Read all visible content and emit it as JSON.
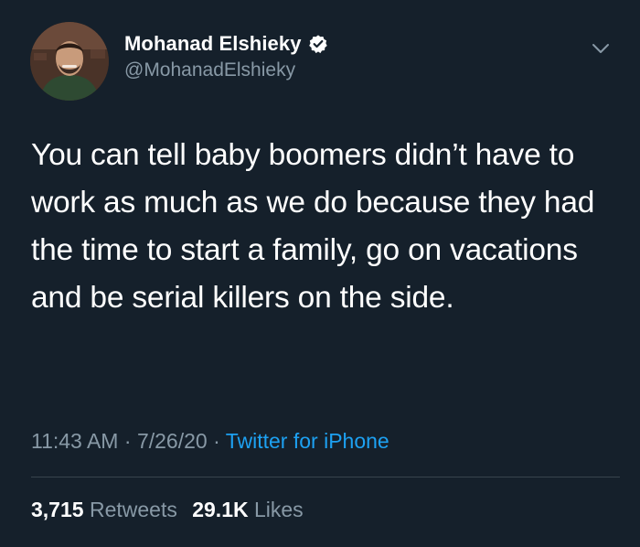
{
  "author": {
    "name": "Mohanad Elshieky",
    "handle": "@MohanadElshieky",
    "verified": true
  },
  "tweet": {
    "text": "You can tell baby boomers didn’t have to work as much as we do because they had the time to start a family, go on vacations and be serial killers on the side.",
    "time": "11:43 AM",
    "date": "7/26/20",
    "source": "Twitter for iPhone",
    "separator": "·"
  },
  "stats": {
    "retweets_count": "3,715",
    "retweets_label": "Retweets",
    "likes_count": "29.1K",
    "likes_label": "Likes"
  },
  "icons": {
    "verified": "verified-badge-icon",
    "more": "chevron-down-icon"
  },
  "colors": {
    "background": "#15202b",
    "secondary_text": "#8899a6",
    "accent": "#1da1f2",
    "divider": "#38444d"
  }
}
